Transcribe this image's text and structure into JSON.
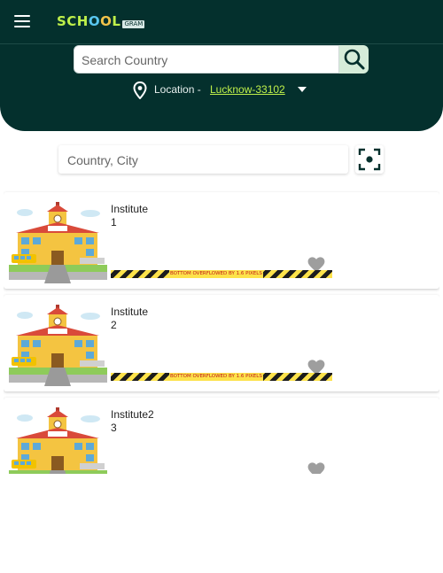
{
  "app": {
    "logo_text": [
      "SCH",
      "O",
      "O",
      "L"
    ],
    "logo_badge": "GRAM"
  },
  "search": {
    "placeholder": "Search Country"
  },
  "location": {
    "label": "Location -",
    "value": "Lucknow-33102"
  },
  "city_search": {
    "placeholder": "Country, City"
  },
  "institutes": [
    {
      "name": "Institute",
      "number": "1",
      "favorite": false,
      "overflow_warning": "BOTTOM OVERFLOWED BY 1.6 PIXELS"
    },
    {
      "name": "Institute",
      "number": "2",
      "favorite": false,
      "overflow_warning": "BOTTOM OVERFLOWED BY 1.6 PIXELS"
    },
    {
      "name": "Institute2",
      "number": "3",
      "favorite": false
    }
  ],
  "colors": {
    "primary": "#04302d",
    "accent": "#bff04a",
    "search_button": "#d6ecd9",
    "heart": "#9e9e9e"
  },
  "icons": {
    "menu": "menu-icon",
    "search": "search-icon",
    "location": "location-pin-icon",
    "caret": "caret-down-icon",
    "scan": "focus-scan-icon",
    "favorite": "heart-icon"
  }
}
